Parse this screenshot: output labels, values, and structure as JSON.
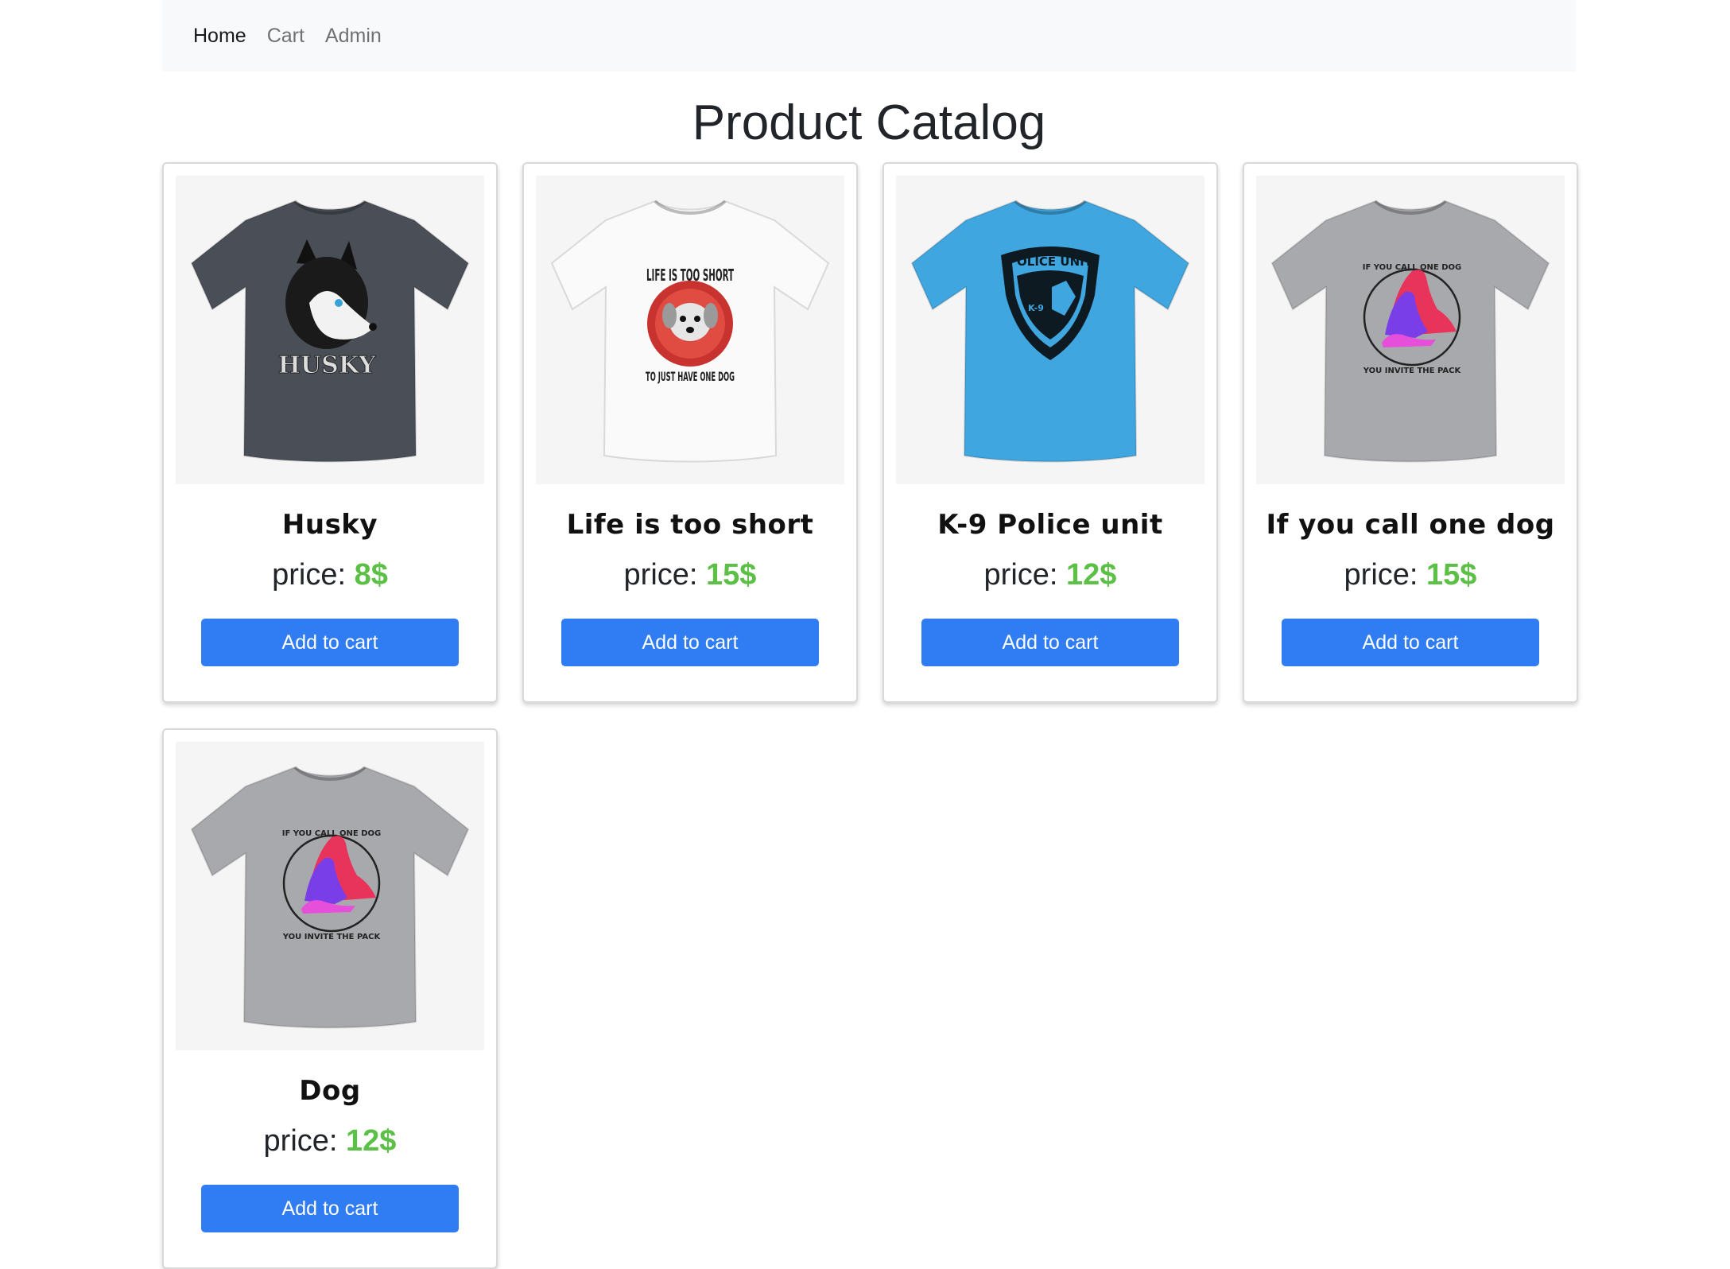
{
  "nav": {
    "items": [
      {
        "label": "Home",
        "active": true
      },
      {
        "label": "Cart",
        "active": false
      },
      {
        "label": "Admin",
        "active": false
      }
    ]
  },
  "page_title": "Product Catalog",
  "price_label": "price:",
  "products": [
    {
      "name": "Husky",
      "price": "8$",
      "button": "Add to cart",
      "shirt_color": "#4a4f57",
      "design": "husky"
    },
    {
      "name": "Life is too short",
      "price": "15$",
      "button": "Add to cart",
      "shirt_color": "#fafafa",
      "design": "life"
    },
    {
      "name": "K-9 Police unit",
      "price": "12$",
      "button": "Add to cart",
      "shirt_color": "#3fa6e0",
      "design": "police"
    },
    {
      "name": "If you call one dog",
      "price": "15$",
      "button": "Add to cart",
      "shirt_color": "#a8a9ad",
      "design": "pack"
    },
    {
      "name": "Dog",
      "price": "12$",
      "button": "Add to cart",
      "shirt_color": "#a8a9ad",
      "design": "pack"
    }
  ],
  "designs": {
    "husky": {
      "text": "HUSKY"
    },
    "life": {
      "top": "LIFE IS TOO SHORT",
      "bottom": "TO JUST HAVE ONE DOG"
    },
    "police": {
      "text": "POLICE UNIT",
      "badge": "K-9"
    },
    "pack": {
      "top": "IF YOU CALL ONE DOG",
      "bottom": "YOU INVITE THE PACK"
    }
  },
  "colors": {
    "accent": "#2f7cf3",
    "price": "#5cc046",
    "navbar_bg": "#f8f9fa"
  }
}
